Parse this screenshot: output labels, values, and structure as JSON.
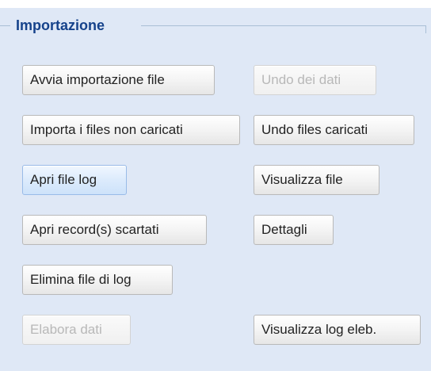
{
  "fieldset": {
    "legend": "Importazione"
  },
  "buttons": {
    "avvia_importazione": {
      "label": "Avvia importazione file",
      "enabled": true
    },
    "undo_dati": {
      "label": "Undo dei dati",
      "enabled": false
    },
    "importa_non_caricati": {
      "label": "Importa i files non caricati",
      "enabled": true
    },
    "undo_files_caricati": {
      "label": "Undo files caricati",
      "enabled": true
    },
    "apri_file_log": {
      "label": "Apri file log",
      "enabled": true,
      "hovered": true
    },
    "visualizza_file": {
      "label": "Visualizza file",
      "enabled": true
    },
    "apri_record_scartati": {
      "label": "Apri record(s) scartati",
      "enabled": true
    },
    "dettagli": {
      "label": "Dettagli",
      "enabled": true
    },
    "elimina_file_log": {
      "label": "Elimina file di log",
      "enabled": true
    },
    "elabora_dati": {
      "label": "Elabora dati",
      "enabled": false
    },
    "visualizza_log_elab": {
      "label": "Visualizza log eleb.",
      "enabled": true
    }
  },
  "colors": {
    "panel_background": "#dfe8f6",
    "legend_text": "#15428b",
    "fieldset_border": "#a9bfd6",
    "disabled_text": "#b8b8b8"
  }
}
